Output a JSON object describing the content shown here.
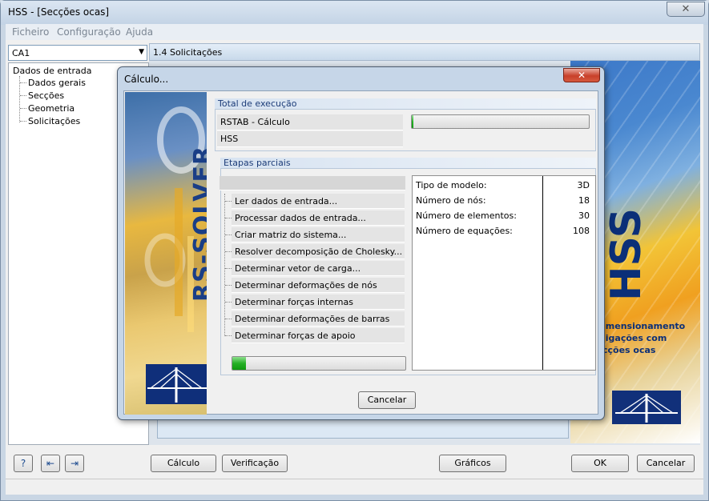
{
  "window": {
    "title": "HSS - [Secções ocas]",
    "close_glyph": "✕"
  },
  "menu": [
    "Ficheiro",
    "Configuração",
    "Ajuda"
  ],
  "combo": {
    "value": "CA1"
  },
  "tree": {
    "root": "Dados de entrada",
    "children": [
      "Dados gerais",
      "Secções",
      "Geometria",
      "Solicitações"
    ]
  },
  "header": {
    "title": "1.4 Solicitações"
  },
  "banner": {
    "product": "HSS",
    "line1": "imensionamento",
    "line2": "ligações com",
    "line3": "cções ocas"
  },
  "bottom": {
    "calc_label": "Cálculo",
    "verify_label": "Verificação",
    "graphics_label": "Gráficos",
    "ok_label": "OK",
    "cancel_label": "Cancelar"
  },
  "dialog": {
    "title": "Cálculo...",
    "close_glyph": "✕",
    "solver_label": "RS-SOLVER",
    "total": {
      "heading": "Total de execução",
      "row1": "RSTAB - Cálculo",
      "row2": "HSS",
      "progress": 0.01
    },
    "partial": {
      "heading": "Etapas parciais",
      "steps": [
        "Ler dados de entrada...",
        "Processar dados de entrada...",
        "Criar matriz do sistema...",
        "Resolver decomposição de Cholesky...",
        "Determinar vetor de carga...",
        "Determinar deformações de nós",
        "Determinar forças internas",
        "Determinar deformações de barras",
        "Determinar forças de apoio"
      ],
      "progress": 0.08
    },
    "stats": [
      {
        "label": "Tipo de modelo:",
        "value": "3D"
      },
      {
        "label": "Número de nós:",
        "value": "18"
      },
      {
        "label": "Número de elementos:",
        "value": "30"
      },
      {
        "label": "Número de equações:",
        "value": "108"
      }
    ],
    "cancel_label": "Cancelar"
  },
  "colors": {
    "accent": "#1c3c78",
    "progress": "#25b025",
    "close_red": "#c8402a"
  }
}
